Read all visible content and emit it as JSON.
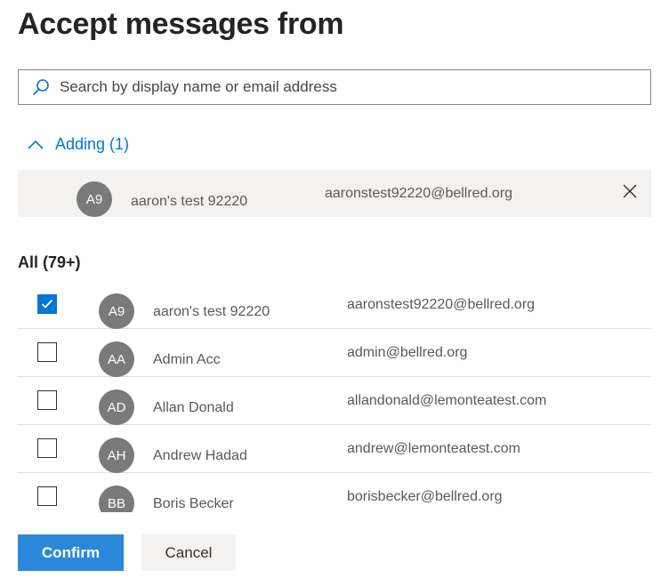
{
  "page": {
    "title": "Accept messages from"
  },
  "search": {
    "placeholder": "Search by display name or email address"
  },
  "adding": {
    "toggle_label": "Adding (1)",
    "items": [
      {
        "initials": "A9",
        "name": "aaron's test 92220",
        "email": "aaronstest92220@bellred.org"
      }
    ]
  },
  "all": {
    "header": "All (79+)",
    "items": [
      {
        "initials": "A9",
        "name": "aaron's test 92220",
        "email": "aaronstest92220@bellred.org",
        "checked": true
      },
      {
        "initials": "AA",
        "name": "Admin Acc",
        "email": "admin@bellred.org",
        "checked": false
      },
      {
        "initials": "AD",
        "name": "Allan Donald",
        "email": "allandonald@lemonteatest.com",
        "checked": false
      },
      {
        "initials": "AH",
        "name": "Andrew Hadad",
        "email": "andrew@lemonteatest.com",
        "checked": false
      },
      {
        "initials": "BB",
        "name": "Boris Becker",
        "email": "borisbecker@bellred.org",
        "checked": false
      }
    ]
  },
  "actions": {
    "confirm_label": "Confirm",
    "cancel_label": "Cancel"
  },
  "colors": {
    "accent": "#0078d4",
    "primary_button": "#2b88d8",
    "avatar": "#7a7a7a",
    "selected_row_bg": "#f3f2f1"
  },
  "icons": {
    "search": "search-icon",
    "collapse": "chevron-up-icon",
    "remove": "close-icon",
    "check": "checkmark-icon"
  }
}
